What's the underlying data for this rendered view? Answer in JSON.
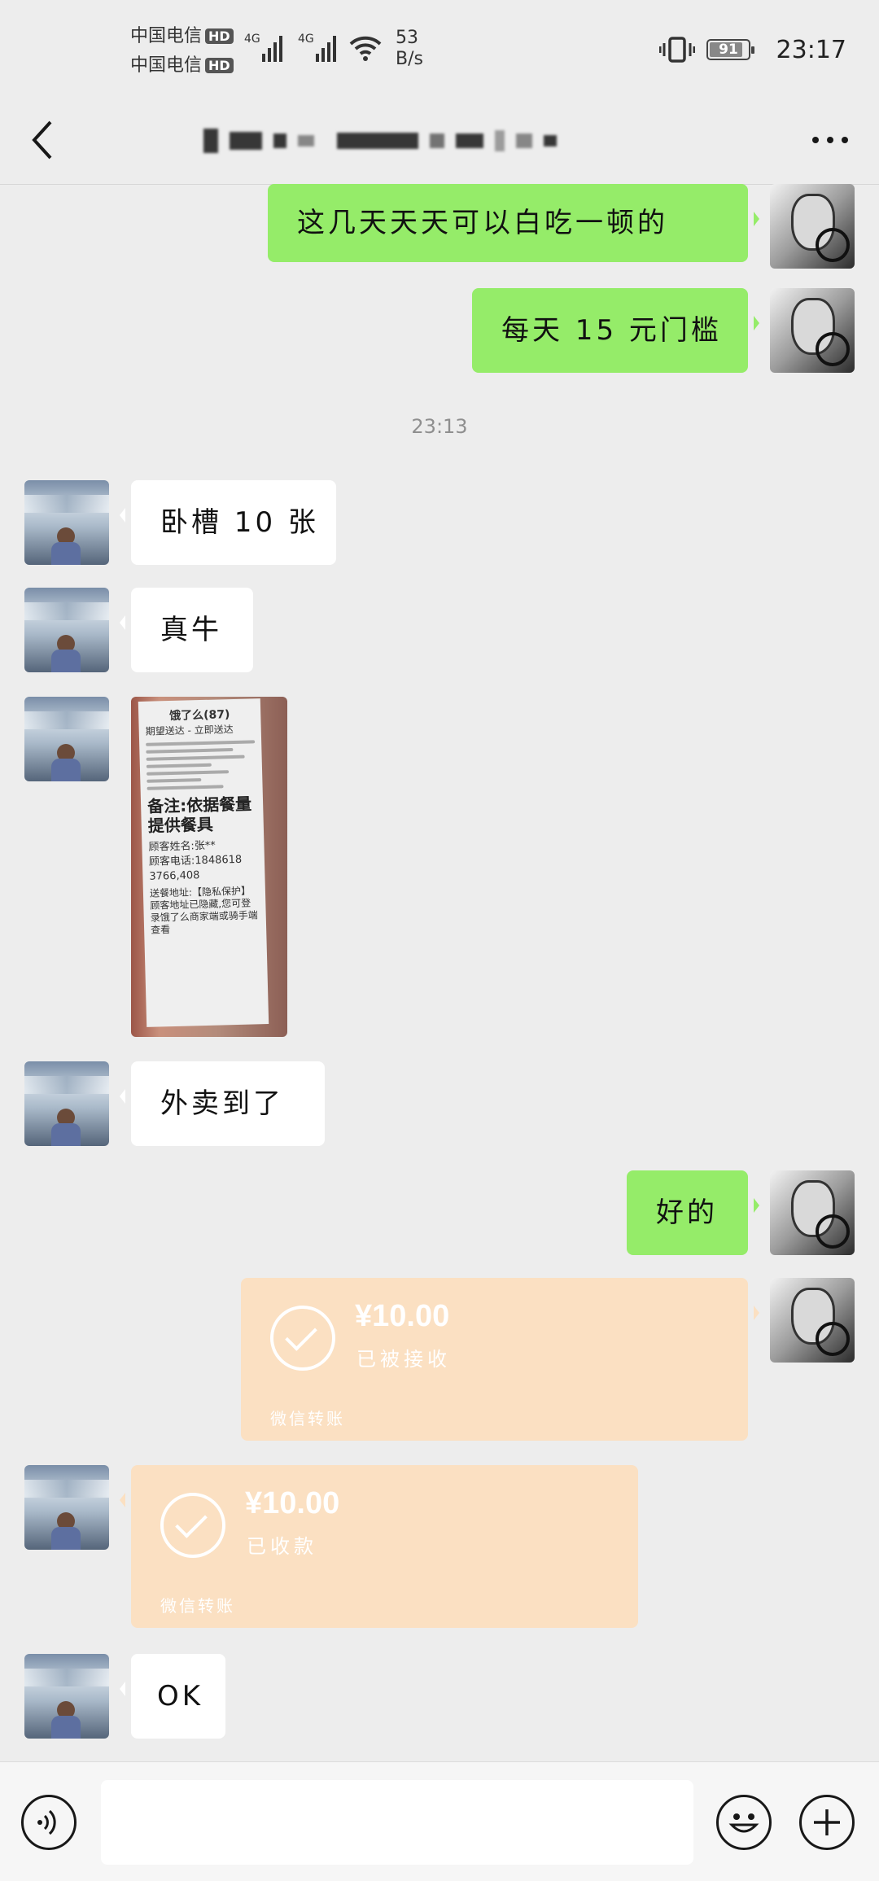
{
  "status_bar": {
    "carrier1": "中国电信",
    "carrier2": "中国电信",
    "hd_badge": "HD",
    "network_type": "4G",
    "net_speed_value": "53",
    "net_speed_unit": "B/s",
    "battery_level": "91",
    "time": "23:17"
  },
  "title_bar": {
    "icons": {
      "back": "back-arrow-icon",
      "more": "more-icon"
    }
  },
  "messages": [
    {
      "side": "right",
      "type": "text",
      "text": "这几天天天可以白吃一顿的"
    },
    {
      "side": "right",
      "type": "text",
      "text": "每天 15 元门槛"
    },
    {
      "type": "timestamp",
      "text": "23:13"
    },
    {
      "side": "left",
      "type": "text",
      "text": "卧槽 10 张"
    },
    {
      "side": "left",
      "type": "text",
      "text": "真牛"
    },
    {
      "side": "left",
      "type": "image",
      "receipt": {
        "header": "饿了么(87)",
        "subheader": "期望送达 - 立即送达",
        "note": "备注:依据餐量提供餐具",
        "customer_name": "顾客姓名:张**",
        "phone": "顾客电话:1848618 3766,408",
        "privacy": "送餐地址:【隐私保护】顾客地址已隐藏,您可登录饿了么商家端或骑手端查看"
      }
    },
    {
      "side": "left",
      "type": "text",
      "text": "外卖到了"
    },
    {
      "side": "right",
      "type": "text",
      "text": "好的"
    },
    {
      "side": "right",
      "type": "transfer",
      "amount": "¥10.00",
      "status": "已被接收",
      "footer": "微信转账"
    },
    {
      "side": "left",
      "type": "transfer",
      "amount": "¥10.00",
      "status": "已收款",
      "footer": "微信转账"
    },
    {
      "side": "left",
      "type": "text",
      "text": "OK"
    }
  ],
  "input_bar": {
    "input_value": "",
    "icons": {
      "voice": "voice-icon",
      "emoji": "emoji-icon",
      "add": "plus-icon"
    }
  },
  "colors": {
    "background": "#ededed",
    "outgoing_bubble": "#95ec69",
    "incoming_bubble": "#ffffff",
    "transfer_bubble": "#fbe0c2"
  }
}
